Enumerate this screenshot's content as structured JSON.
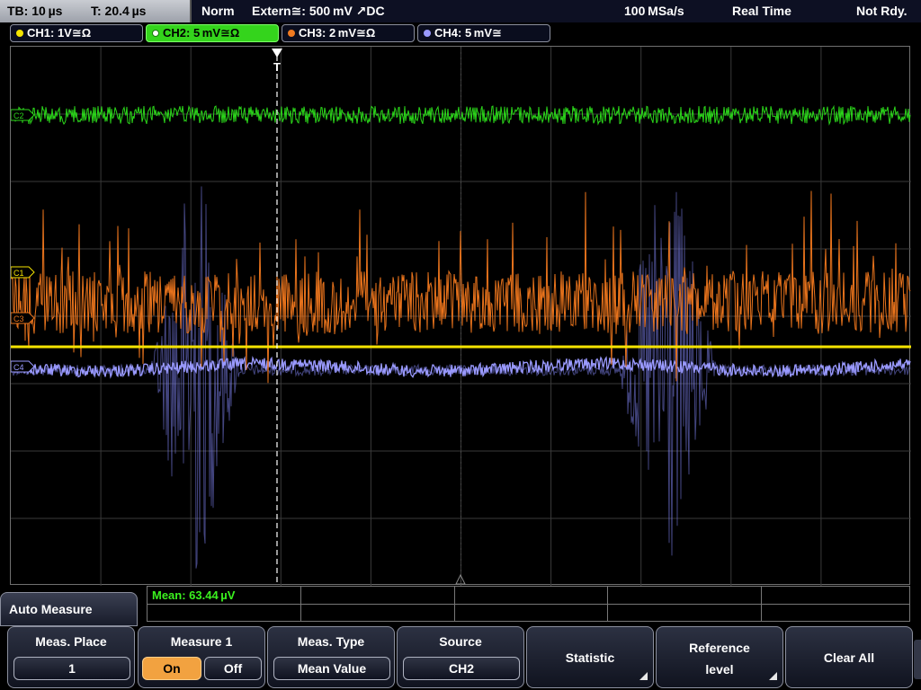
{
  "top_bar": {
    "timebase": "TB: 10 µs",
    "trigger_time": "T: 20.4 µs",
    "mode": "Norm",
    "trigger": "Extern≅: 500 mV ↗DC",
    "sample_rate": "100 MSa/s",
    "acq_mode": "Real Time",
    "status": "Not Rdy."
  },
  "channels": [
    {
      "label": "CH1: 1V≅Ω",
      "color": "#f5e400",
      "active": false
    },
    {
      "label": "CH2: 5 mV≅Ω",
      "color": "#2bd61a",
      "active": true
    },
    {
      "label": "CH3: 2 mV≅Ω",
      "color": "#f07a20",
      "active": false
    },
    {
      "label": "CH4: 5 mV≅",
      "color": "#9a9aff",
      "active": false
    }
  ],
  "markers": {
    "ch2": "C2",
    "ch1": "C1",
    "ch3": "C3",
    "ch4": "C4",
    "trigger": "T"
  },
  "measurement": {
    "result": "Mean: 63.44 µV"
  },
  "menu": {
    "title": "Auto Measure",
    "meas_place_label": "Meas. Place",
    "meas_place_value": "1",
    "measure_label": "Measure 1",
    "measure_on": "On",
    "measure_off": "Off",
    "meas_type_label": "Meas. Type",
    "meas_type_value": "Mean Value",
    "source_label": "Source",
    "source_value": "CH2",
    "statistic_label": "Statistic",
    "reference_label_1": "Reference",
    "reference_label_2": "level",
    "clear_all_label": "Clear All"
  }
}
